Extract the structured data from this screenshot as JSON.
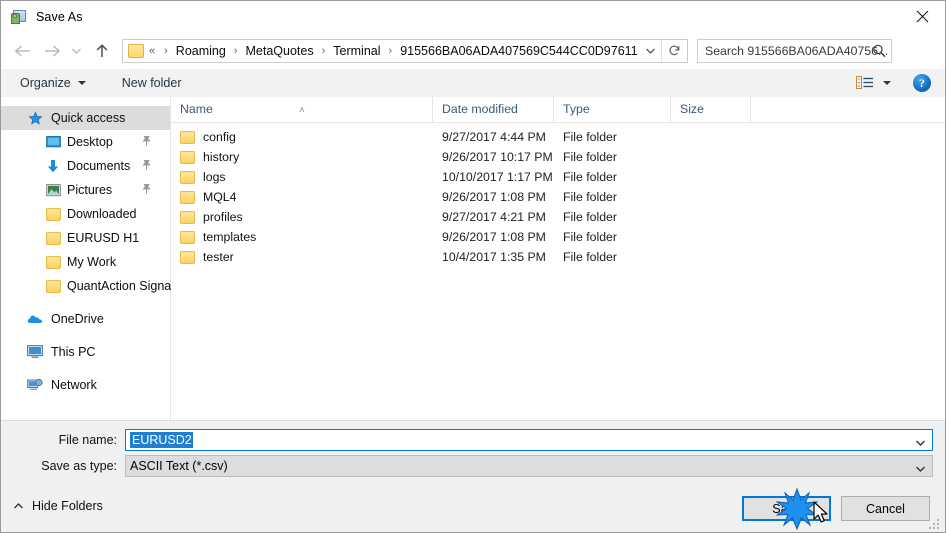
{
  "window": {
    "title": "Save As",
    "app_icon": "save-as-icon",
    "close_icon": "close-icon"
  },
  "nav": {
    "back_icon": "arrow-left-icon",
    "forward_icon": "arrow-right-icon",
    "recent_icon": "chevron-down-icon",
    "up_icon": "arrow-up-icon",
    "breadcrumb_prefix": "«",
    "breadcrumbs": [
      "Roaming",
      "MetaQuotes",
      "Terminal",
      "915566BA06ADA407569C544CC0D97611"
    ],
    "separator": "›",
    "dropdown_icon": "chevron-down-icon",
    "refresh_icon": "refresh-icon"
  },
  "search": {
    "placeholder": "Search 915566BA06ADA40756...",
    "icon": "search-icon"
  },
  "toolbar": {
    "organize_label": "Organize",
    "new_folder_label": "New folder",
    "view_icon": "view-layout-icon",
    "help_label": "?",
    "help_icon": "help-icon"
  },
  "sidebar": {
    "items": [
      {
        "label": "Quick access",
        "icon": "star-icon",
        "selected": true,
        "pinned": false,
        "level": 0
      },
      {
        "label": "Desktop",
        "icon": "desktop-icon",
        "selected": false,
        "pinned": true,
        "level": 1
      },
      {
        "label": "Documents",
        "icon": "documents-download-icon",
        "selected": false,
        "pinned": true,
        "level": 1
      },
      {
        "label": "Pictures",
        "icon": "pictures-icon",
        "selected": false,
        "pinned": true,
        "level": 1
      },
      {
        "label": "Downloaded",
        "icon": "folder-icon",
        "selected": false,
        "pinned": false,
        "level": 1
      },
      {
        "label": "EURUSD H1",
        "icon": "folder-icon",
        "selected": false,
        "pinned": false,
        "level": 1
      },
      {
        "label": "My Work",
        "icon": "folder-icon",
        "selected": false,
        "pinned": false,
        "level": 1
      },
      {
        "label": "QuantAction Signal",
        "icon": "folder-icon",
        "selected": false,
        "pinned": false,
        "level": 1
      }
    ],
    "groups": [
      {
        "label": "OneDrive",
        "icon": "onedrive-icon"
      },
      {
        "label": "This PC",
        "icon": "this-pc-icon"
      },
      {
        "label": "Network",
        "icon": "network-icon"
      }
    ]
  },
  "filelist": {
    "columns": [
      "Name",
      "Date modified",
      "Type",
      "Size"
    ],
    "sort_indicator": "˄",
    "rows": [
      {
        "name": "config",
        "date": "9/27/2017 4:44 PM",
        "type": "File folder",
        "size": ""
      },
      {
        "name": "history",
        "date": "9/26/2017 10:17 PM",
        "type": "File folder",
        "size": ""
      },
      {
        "name": "logs",
        "date": "10/10/2017 1:17 PM",
        "type": "File folder",
        "size": ""
      },
      {
        "name": "MQL4",
        "date": "9/26/2017 1:08 PM",
        "type": "File folder",
        "size": ""
      },
      {
        "name": "profiles",
        "date": "9/27/2017 4:21 PM",
        "type": "File folder",
        "size": ""
      },
      {
        "name": "templates",
        "date": "9/26/2017 1:08 PM",
        "type": "File folder",
        "size": ""
      },
      {
        "name": "tester",
        "date": "10/4/2017 1:35 PM",
        "type": "File folder",
        "size": ""
      }
    ]
  },
  "form": {
    "file_name_label": "File name:",
    "file_name_value": "EURUSD2",
    "save_as_type_label": "Save as type:",
    "save_as_type_value": "ASCII Text (*.csv)",
    "dropdown_icon": "chevron-down-icon"
  },
  "footer": {
    "hide_folders_label": "Hide Folders",
    "hide_folders_icon": "chevron-up-icon",
    "save_label": "Save",
    "cancel_label": "Cancel",
    "resize_grip_icon": "resize-grip-icon",
    "click_effect_icon": "click-burst-icon",
    "cursor_icon": "mouse-pointer-icon"
  },
  "colors": {
    "accent": "#0078d7",
    "selection": "#1f7fd1",
    "sidebar_selection": "#dcdcdc",
    "folder_yellow": "#fcd462",
    "header_text": "#3b5a7a"
  }
}
